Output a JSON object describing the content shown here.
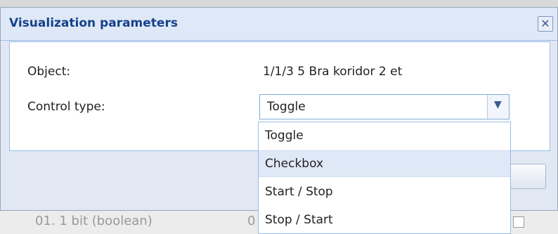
{
  "dialog": {
    "title": "Visualization parameters",
    "close_symbol": "✕"
  },
  "form": {
    "object_label": "Object:",
    "object_value": "1/1/3 5 Bra koridor 2 et",
    "control_type_label": "Control type:",
    "control_type_value": "Toggle"
  },
  "dropdown": {
    "options": [
      "Toggle",
      "Checkbox",
      "Start / Stop",
      "Stop / Start"
    ],
    "highlighted_index": 1
  },
  "background_row": {
    "left_text": "01. 1 bit (boolean)",
    "mid_text": "0"
  },
  "icons": {
    "close": "close-icon",
    "dropdown_arrow": "chevron-down-icon"
  },
  "colors": {
    "title": "#15428b",
    "header_bg": "#dfe8f6",
    "highlight_bg": "#dfe8f6",
    "border": "#99bbe8"
  }
}
